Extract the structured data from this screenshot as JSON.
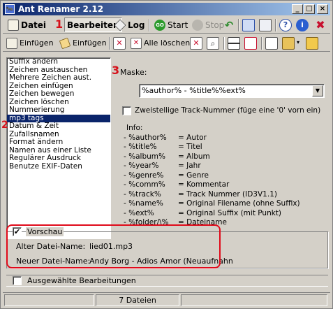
{
  "window": {
    "title": "Ant Renamer 2.12"
  },
  "menu": {
    "datei": "Datei",
    "bearbeiten": "Bearbeiten",
    "log": "Log",
    "start": "Start",
    "stop": "Stop"
  },
  "toolbar2": {
    "einfuegen1": "Einfügen",
    "einfuegen2": "Einfügen",
    "alle_loeschen": "Alle löschen"
  },
  "annotations": {
    "one": "1",
    "two": "2",
    "three": "3"
  },
  "actions": [
    "Suffix ändern",
    "Zeichen austauschen",
    "Mehrere Zeichen aust.",
    "Zeichen einfügen",
    "Zeichen bewegen",
    "Zeichen löschen",
    "Nummerierung",
    "mp3 tags",
    "Datum & Zeit",
    "Zufallsnamen",
    "Format ändern",
    "Namen aus einer Liste",
    "Regulärer Ausdruck",
    "Benutze EXIF-Daten"
  ],
  "selected_index": 7,
  "mask": {
    "label": "Maske:",
    "value": "%author% - %title%%ext%"
  },
  "track_option": {
    "label": "Zweistellige Track-Nummer (füge eine '0' vorn ein)",
    "checked": false
  },
  "info": {
    "heading": "Info:",
    "rows": [
      {
        "k": "- %author%",
        "v": "= Autor"
      },
      {
        "k": "- %title%",
        "v": "= Titel"
      },
      {
        "k": "- %album%",
        "v": "= Album"
      },
      {
        "k": "- %year%",
        "v": "= Jahr"
      },
      {
        "k": "- %genre%",
        "v": "= Genre"
      },
      {
        "k": "- %comm%",
        "v": "= Kommentar"
      },
      {
        "k": "- %track%",
        "v": "= Track Nummer (ID3V1.1)"
      },
      {
        "k": "- %name%",
        "v": "= Original Filename (ohne Suffix)"
      },
      {
        "k": "- %ext%",
        "v": "= Original Suffix (mit Punkt)"
      },
      {
        "k": "- %folder/\\%",
        "v": "= Dateiname"
      }
    ]
  },
  "preview": {
    "label": "Vorschau",
    "checked": true,
    "old_label": "Alter Datei-Name:",
    "old_value": "lied01.mp3",
    "new_label": "Neuer Datei-Name:",
    "new_value": "Andy Borg - Adios Amor (Neuaufnahn"
  },
  "selected_ops": {
    "label": "Ausgewählte Bearbeitungen",
    "checked": false
  },
  "status": {
    "count": "7 Dateien"
  },
  "colors": {
    "annotation_red": "#e00a1a",
    "selection": "#0a246a"
  }
}
